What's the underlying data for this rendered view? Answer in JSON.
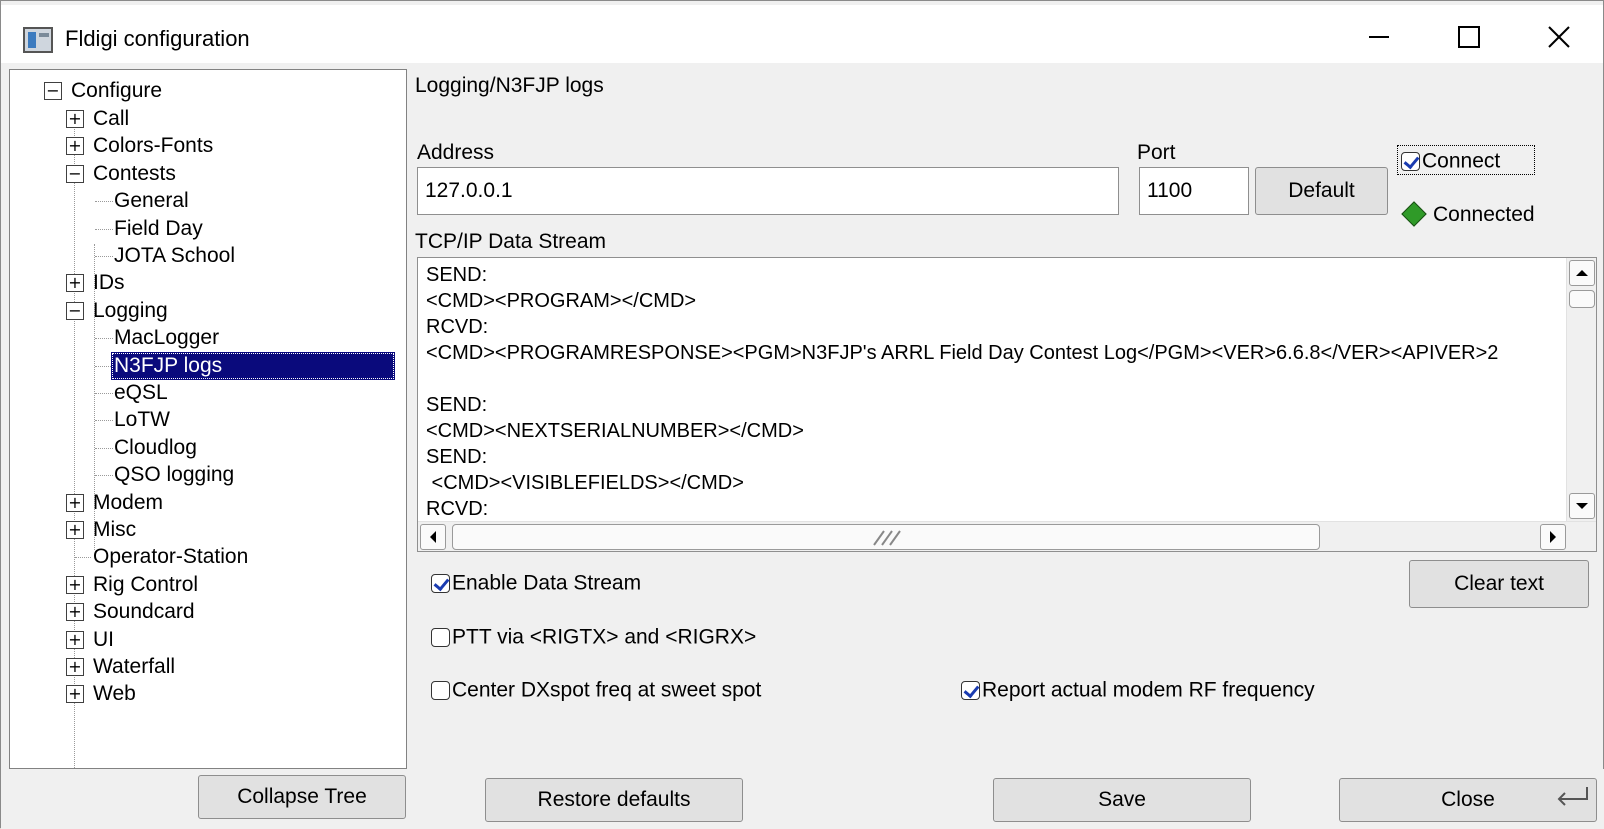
{
  "window": {
    "title": "Fldigi configuration"
  },
  "tree": {
    "root": "Configure",
    "items": [
      {
        "label": "Call",
        "expander": "+"
      },
      {
        "label": "Colors-Fonts",
        "expander": "+"
      },
      {
        "label": "Contests",
        "expander": "−"
      },
      {
        "label": "General"
      },
      {
        "label": "Field Day"
      },
      {
        "label": "JOTA School"
      },
      {
        "label": "IDs",
        "expander": "+"
      },
      {
        "label": "Logging",
        "expander": "−"
      },
      {
        "label": "MacLogger"
      },
      {
        "label": "N3FJP logs",
        "selected": true
      },
      {
        "label": "eQSL"
      },
      {
        "label": "LoTW"
      },
      {
        "label": "Cloudlog"
      },
      {
        "label": "QSO logging"
      },
      {
        "label": "Modem",
        "expander": "+"
      },
      {
        "label": "Misc",
        "expander": "+"
      },
      {
        "label": "Operator-Station"
      },
      {
        "label": "Rig Control",
        "expander": "+"
      },
      {
        "label": "Soundcard",
        "expander": "+"
      },
      {
        "label": "UI",
        "expander": "+"
      },
      {
        "label": "Waterfall",
        "expander": "+"
      },
      {
        "label": "Web",
        "expander": "+"
      }
    ]
  },
  "panel": {
    "title": "Logging/N3FJP logs",
    "address_label": "Address",
    "address_value": "127.0.0.1",
    "port_label": "Port",
    "port_value": "1100",
    "default_button": "Default",
    "connect_label": "Connect",
    "connect_checked": true,
    "status_text": "Connected",
    "status_color": "#2f9a28",
    "stream_label": "TCP/IP Data Stream",
    "stream_lines": [
      "SEND:",
      "<CMD><PROGRAM></CMD>",
      "RCVD:",
      "<CMD><PROGRAMRESPONSE><PGM>N3FJP's ARRL Field Day Contest Log</PGM><VER>6.6.8</VER><APIVER>2",
      "",
      "SEND:",
      "<CMD><NEXTSERIALNUMBER></CMD>",
      "SEND:",
      " <CMD><VISIBLEFIELDS></CMD>",
      "RCVD:"
    ],
    "enable_stream_label": "Enable Data Stream",
    "enable_stream_checked": true,
    "clear_text_button": "Clear text",
    "ptt_label": "PTT via <RIGTX> and <RIGRX>",
    "ptt_checked": false,
    "center_dx_label": "Center DXspot freq at sweet spot",
    "center_dx_checked": false,
    "report_rf_label": "Report actual modem RF frequency",
    "report_rf_checked": true
  },
  "footer": {
    "collapse_tree": "Collapse Tree",
    "restore_defaults": "Restore defaults",
    "save": "Save",
    "close": "Close"
  },
  "icons": {
    "app": "fldigi-app-icon",
    "minimize": "minimize-icon",
    "maximize": "maximize-icon",
    "close": "close-icon",
    "status": "diamond-led-icon"
  }
}
